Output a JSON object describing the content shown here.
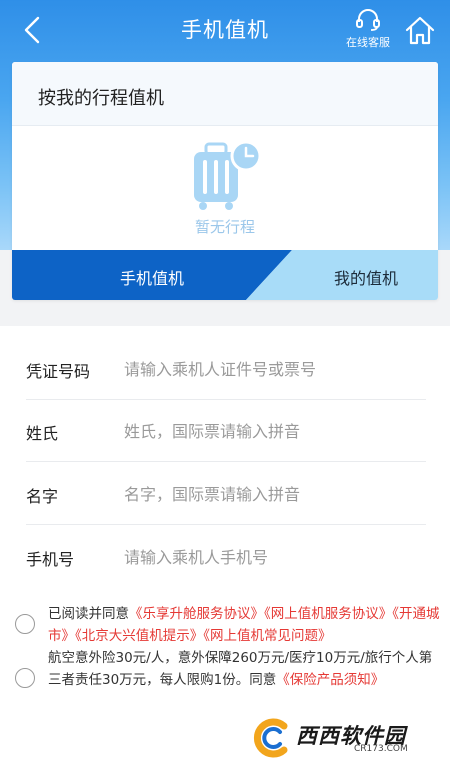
{
  "header": {
    "title": "手机值机",
    "service_label": "在线客服"
  },
  "itinerary": {
    "heading": "按我的行程值机",
    "empty_text": "暂无行程"
  },
  "tabs": [
    {
      "label": "手机值机",
      "active": true
    },
    {
      "label": "我的值机",
      "active": false
    }
  ],
  "form": {
    "fields": [
      {
        "label": "凭证号码",
        "placeholder": "请输入乘机人证件号或票号",
        "value": ""
      },
      {
        "label": "姓氏",
        "placeholder": "姓氏，国际票请输入拼音",
        "value": ""
      },
      {
        "label": "名字",
        "placeholder": "名字，国际票请输入拼音",
        "value": ""
      },
      {
        "label": "手机号",
        "placeholder": "请输入乘机人手机号",
        "value": ""
      }
    ]
  },
  "agreement": {
    "prefix": "已阅读并同意",
    "links": [
      "《乐享升舱服务协议》",
      "《网上值机服务协议》",
      "《开通城市》",
      "《北京大兴值机提示》",
      "《网上值机常见问题》"
    ]
  },
  "insurance": {
    "text": "航空意外险30元/人，意外保障260万元/医疗10万元/旅行个人第三者责任30万元，每人限购1份。同意",
    "link": "《保险产品须知》"
  },
  "watermark": {
    "main": "西西软件园",
    "sub": "CR173.COM"
  },
  "colors": {
    "header_gradient_top": "#2f8fe8",
    "tab_active": "#0d63c6",
    "tab_inactive": "#a8dcf8",
    "link": "#e53935",
    "empty_icon": "#a9d6f5"
  },
  "icons": {
    "back": "chevron-left-icon",
    "service": "headset-icon",
    "home": "home-icon",
    "empty": "luggage-clock-icon"
  }
}
